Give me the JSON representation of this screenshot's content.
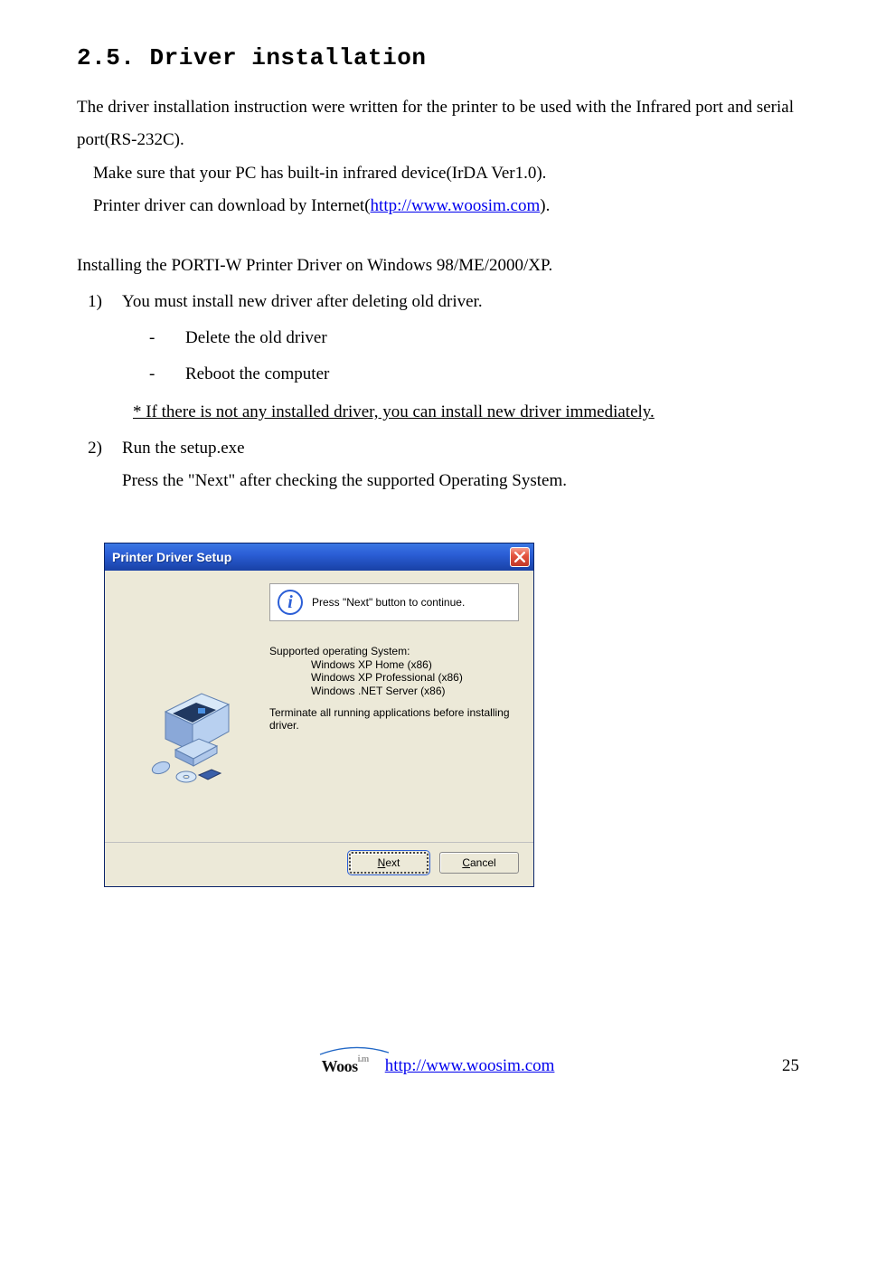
{
  "heading": "2.5. Driver installation",
  "p1a": " The driver installation instruction were written for the printer to be used with the Infrared port and serial port(RS-232C).",
  "p2": "Make sure that your PC has built-in infrared device(IrDA Ver1.0).",
  "p3_pre": "Printer driver can download by Internet(",
  "p3_link": "http://www.woosim.com",
  "p3_post": ").",
  "p4": "Installing the PORTI-W Printer Driver on Windows 98/ME/2000/XP.",
  "li1_num": "1)",
  "li1": "You must install new driver after deleting old driver.",
  "li1_a_dash": "-",
  "li1_a": "Delete the old driver",
  "li1_b_dash": "-",
  "li1_b": "Reboot the computer",
  "li1_note": "* If there is not any installed driver, you can install new driver immediately.",
  "li2_num": "2)",
  "li2": "Run the setup.exe",
  "li2_sub": "Press the \"Next\" after checking the supported Operating System.",
  "dialog": {
    "title": "Printer Driver Setup",
    "info_text": "Press \"Next\" button to continue.",
    "os_heading": "Supported operating System:",
    "os1": "Windows XP Home (x86)",
    "os2": "Windows XP Professional (x86)",
    "os3": "Windows .NET Server (x86)",
    "terminate": "Terminate all running applications before installing driver.",
    "next_pre": "",
    "next_accel": "N",
    "next_post": "ext",
    "cancel_pre": "",
    "cancel_accel": "C",
    "cancel_post": "ancel"
  },
  "footer": {
    "link": "http://www.woosim.com",
    "page": "25",
    "logo_main": "Woos",
    "logo_tail": "i.m"
  }
}
